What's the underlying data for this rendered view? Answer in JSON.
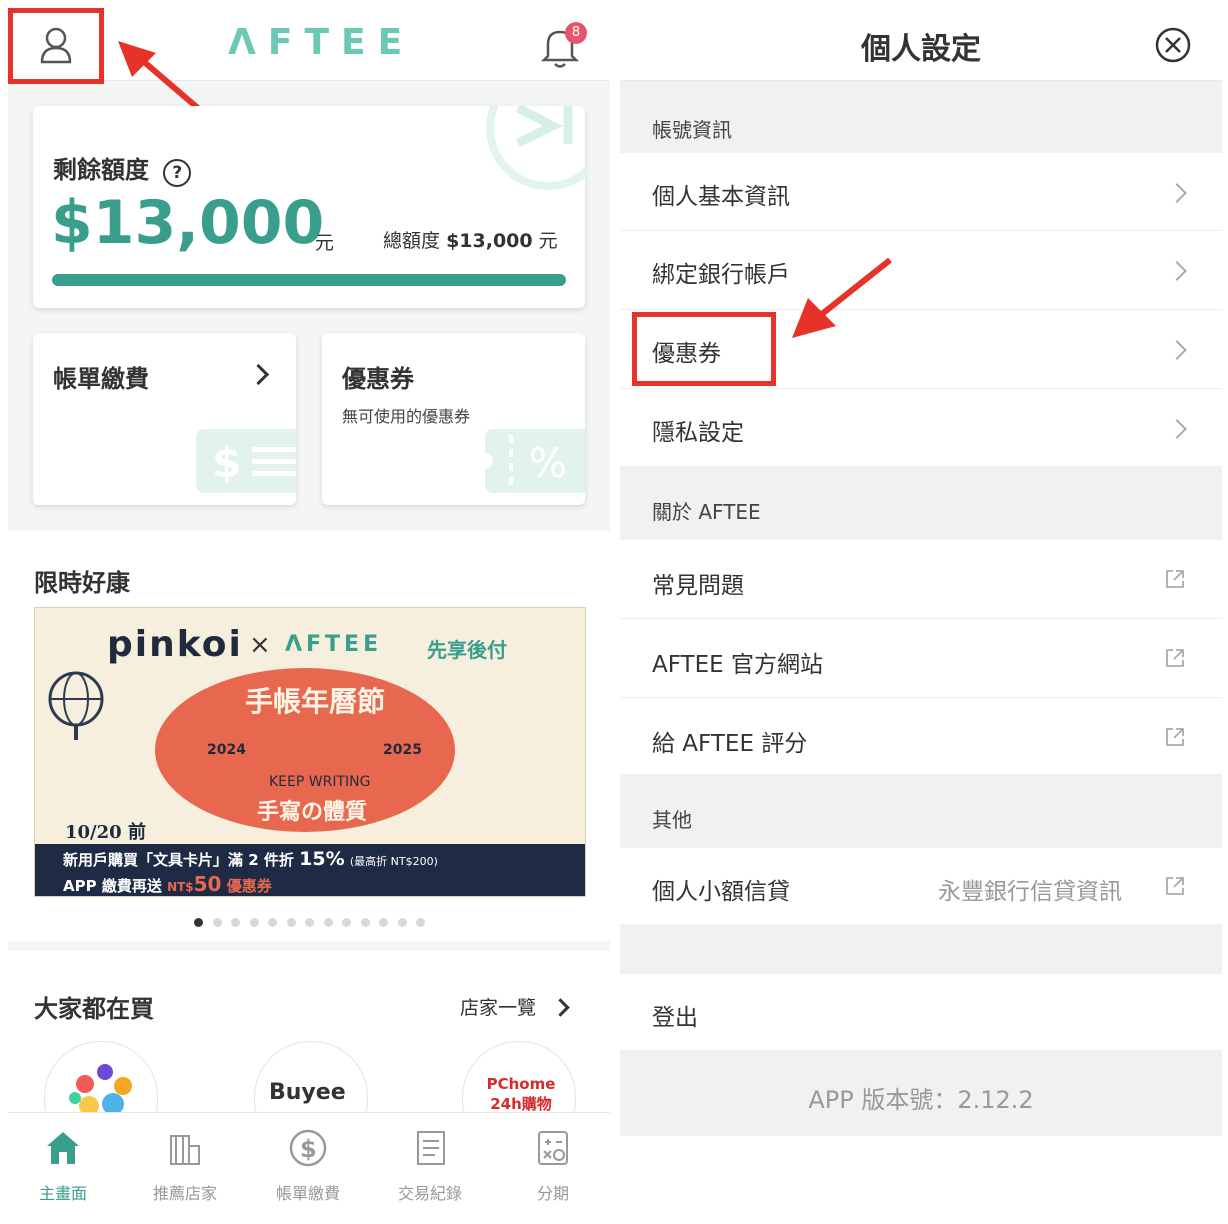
{
  "left": {
    "brand": "ΛFTEE",
    "notification_count": "8",
    "remaining_label": "剩餘額度",
    "help_symbol": "?",
    "remaining_amount": "$13,000",
    "currency_unit": "元",
    "total_label": "總額度",
    "total_amount": "$13,000",
    "total_unit": "元",
    "progress_fraction": 1.0,
    "bill_card_title": "帳單繳費",
    "coupon_card_title": "優惠券",
    "coupon_card_sub": "無可使用的優惠券",
    "promo_section_title": "限時好康",
    "banner": {
      "brand1": "pinkoi",
      "times": "×",
      "brand2": "ΛFTEE",
      "tagline": "先享後付",
      "headline": "手帳年曆節",
      "year_left": "2024",
      "year_right": "2025",
      "keep_writing": "KEEP WRITING",
      "sub_headline": "手寫の體質",
      "deadline": "10/20 前",
      "line1_a": "新用戶購買「文具卡片」滿 2 件折",
      "line1_b": "15%",
      "line1_c": "(最高折 NT$200)",
      "line2_a": "APP 繳費再送",
      "line2_b": "NT$",
      "line2_c": "50",
      "line2_d": "優惠券"
    },
    "carousel_dots_count": 13,
    "popular_title": "大家都在買",
    "store_list_link": "店家一覽",
    "store_logos": [
      "",
      "Buyee",
      "PChome 24h購物"
    ],
    "nav": [
      {
        "label": "主畫面",
        "icon": "home-icon",
        "active": true
      },
      {
        "label": "推薦店家",
        "icon": "building-icon",
        "active": false
      },
      {
        "label": "帳單繳費",
        "icon": "dollar-circle-icon",
        "active": false
      },
      {
        "label": "交易紀錄",
        "icon": "receipt-icon",
        "active": false
      },
      {
        "label": "分期",
        "icon": "calculator-icon",
        "active": false
      }
    ]
  },
  "right": {
    "title": "個人設定",
    "sections": [
      {
        "header": "帳號資訊",
        "rows": [
          "個人基本資訊",
          "綁定銀行帳戶",
          "優惠券",
          "隱私設定"
        ]
      },
      {
        "header": "關於 AFTEE",
        "rows": [
          "常見問題",
          "AFTEE 官方網站",
          "給 AFTEE 評分"
        ]
      },
      {
        "header": "其他",
        "rows": [
          "個人小額信貸"
        ]
      }
    ],
    "loan_link": "永豐銀行信貸資訊",
    "logout": "登出",
    "version": "APP 版本號：2.12.2"
  },
  "colors": {
    "accent": "#3a9e8d",
    "highlight": "#e63228",
    "badge": "#e8556b"
  }
}
